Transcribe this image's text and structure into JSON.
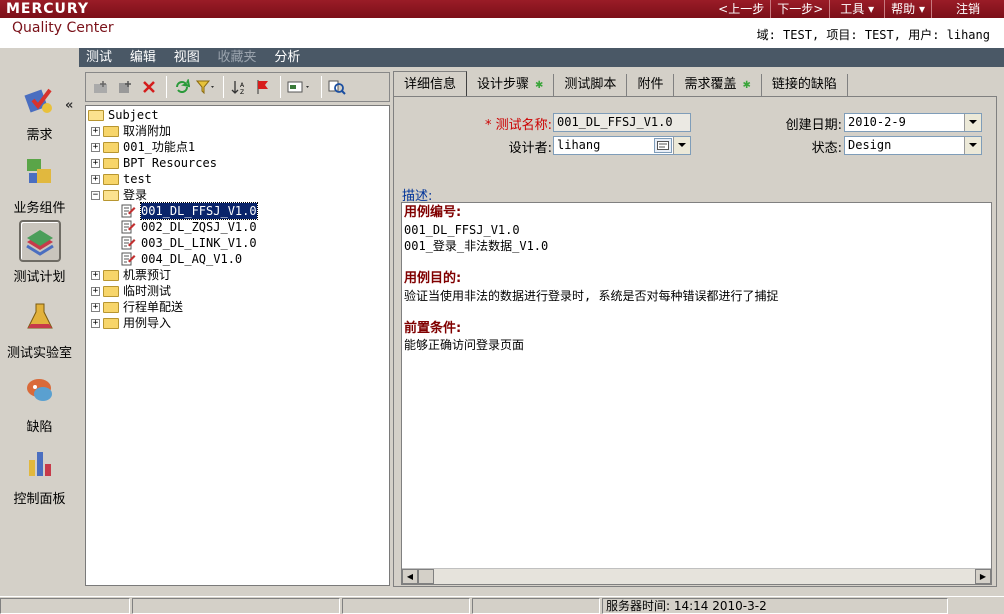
{
  "top": {
    "logo": "MERCURY",
    "nav": [
      "<上一步",
      "下一步>",
      "工具 ▾",
      "帮助 ▾",
      "注销"
    ]
  },
  "product": "Quality Center",
  "context": "域: TEST, 项目: TEST, 用户: lihang",
  "sidebar": {
    "collapse": "«",
    "modules": [
      {
        "label": "需求",
        "icon": "requirements-icon"
      },
      {
        "label": "业务组件",
        "icon": "business-components-icon"
      },
      {
        "label": "测试计划",
        "icon": "test-plan-icon"
      },
      {
        "label": "测试实验室",
        "icon": "test-lab-icon"
      },
      {
        "label": "缺陷",
        "icon": "defects-icon"
      },
      {
        "label": "控制面板",
        "icon": "dashboard-icon"
      }
    ]
  },
  "menu": [
    "测试",
    "编辑",
    "视图",
    "收藏夹",
    "分析"
  ],
  "tree": {
    "root": "Subject",
    "folders_top": [
      "取消附加",
      "001_功能点1",
      "BPT Resources",
      "test"
    ],
    "open_folder": "登录",
    "tests": [
      "001_DL_FFSJ_V1.0",
      "002_DL_ZQSJ_V1.0",
      "003_DL_LINK_V1.0",
      "004_DL_AQ_V1.0"
    ],
    "selected_test": "001_DL_FFSJ_V1.0",
    "folders_bottom": [
      "机票预订",
      "临时测试",
      "行程单配送",
      "用例导入"
    ]
  },
  "tabs": [
    {
      "label": "详细信息",
      "active": true,
      "dot": false
    },
    {
      "label": "设计步骤",
      "active": false,
      "dot": true
    },
    {
      "label": "测试脚本",
      "active": false,
      "dot": false
    },
    {
      "label": "附件",
      "active": false,
      "dot": false
    },
    {
      "label": "需求覆盖",
      "active": false,
      "dot": true
    },
    {
      "label": "链接的缺陷",
      "active": false,
      "dot": false
    }
  ],
  "details": {
    "name_label": "* 测试名称:",
    "name_value": "001_DL_FFSJ_V1.0",
    "designer_label": "设计者:",
    "designer_value": "lihang",
    "created_label": "创建日期:",
    "created_value": "2010-2-9",
    "status_label": "状态:",
    "status_value": "Design",
    "desc_label": "描述:",
    "description": {
      "h1": "用例编号:",
      "p1a": "001_DL_FFSJ_V1.0",
      "p1b": "001_登录_非法数据_V1.0",
      "h2": "用例目的:",
      "p2": "验证当使用非法的数据进行登录时, 系统是否对每种错误都进行了捕捉",
      "h3": "前置条件:",
      "p3": "能够正确访问登录页面"
    }
  },
  "status": {
    "server_time": "服务器时间: 14:14 2010-3-2"
  }
}
